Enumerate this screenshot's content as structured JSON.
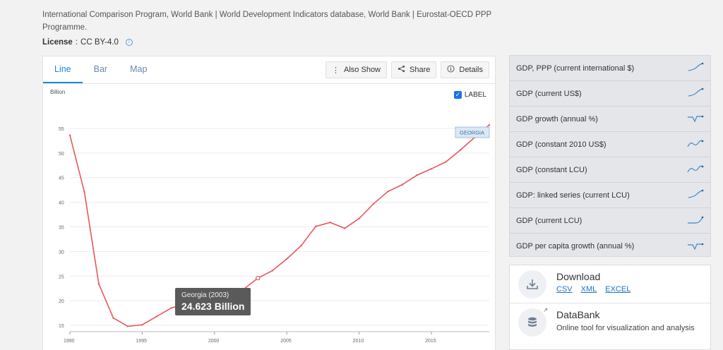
{
  "source": "International Comparison Program, World Bank | World Development Indicators database, World Bank | Eurostat-OECD PPP Programme.",
  "license": {
    "label": "License",
    "sep": ":",
    "value": "CC BY-4.0"
  },
  "tabs": [
    {
      "label": "Line",
      "active": true
    },
    {
      "label": "Bar",
      "active": false
    },
    {
      "label": "Map",
      "active": false
    }
  ],
  "actions": {
    "also_show": "Also Show",
    "share": "Share",
    "details": "Details"
  },
  "label_toggle": {
    "label": "LABEL",
    "checked": true
  },
  "chart_data": {
    "type": "line",
    "ylabel": "Billion",
    "xlim": [
      1990,
      2019
    ],
    "ylim": [
      14,
      57
    ],
    "x_ticks": [
      1990,
      1995,
      2000,
      2005,
      2010,
      2015
    ],
    "y_ticks": [
      15,
      20,
      25,
      30,
      35,
      40,
      45,
      50,
      55
    ],
    "grid": true,
    "color": "#e8575a",
    "series": [
      {
        "name": "GEORGIA",
        "x": [
          1990,
          1991,
          1992,
          1993,
          1994,
          1995,
          1996,
          1997,
          1998,
          1999,
          2000,
          2001,
          2002,
          2003,
          2004,
          2005,
          2006,
          2007,
          2008,
          2009,
          2010,
          2011,
          2012,
          2013,
          2014,
          2015,
          2016,
          2017,
          2018,
          2019
        ],
        "y": [
          53.6,
          42.1,
          23.4,
          16.5,
          14.8,
          15.1,
          16.8,
          18.5,
          19.4,
          19.6,
          20.4,
          21.6,
          22.3,
          24.6,
          26.1,
          28.5,
          31.2,
          35.1,
          35.9,
          34.7,
          36.7,
          39.7,
          42.2,
          43.6,
          45.5,
          46.8,
          48.2,
          50.6,
          53.2,
          55.7
        ]
      }
    ],
    "highlight": {
      "index": 13
    },
    "tooltip": {
      "title": "Georgia (2003)",
      "value": "24.623 Billion"
    },
    "end_label": "GEORGIA"
  },
  "indicators": [
    {
      "label": "GDP, PPP (current international $)",
      "spark": "up-steep"
    },
    {
      "label": "GDP (current US$)",
      "spark": "up-steep"
    },
    {
      "label": "GDP growth (annual %)",
      "spark": "dip"
    },
    {
      "label": "GDP (constant 2010 US$)",
      "spark": "wave"
    },
    {
      "label": "GDP (constant LCU)",
      "spark": "wave"
    },
    {
      "label": "GDP: linked series (current LCU)",
      "spark": "up-steep"
    },
    {
      "label": "GDP (current LCU)",
      "spark": "up-late"
    },
    {
      "label": "GDP per capita growth (annual %)",
      "spark": "dip"
    }
  ],
  "download": {
    "title": "Download",
    "links": [
      "CSV",
      "XML",
      "EXCEL"
    ]
  },
  "databank": {
    "title": "DataBank",
    "subtitle": "Online tool for visualization and analysis"
  },
  "colors": {
    "accent": "#1a8ad4",
    "line": "#e8575a",
    "panel": "#e4e6e9"
  }
}
